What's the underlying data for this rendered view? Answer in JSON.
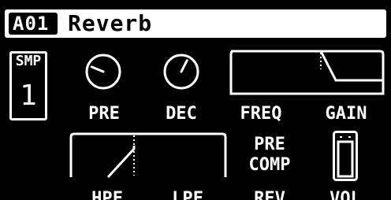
{
  "header": {
    "track_id": "A01",
    "preset_name": "Reverb"
  },
  "source": {
    "label": "SMP",
    "value": "1"
  },
  "params": {
    "pre": {
      "label": "PRE",
      "knob_level": 0.25
    },
    "dec": {
      "label": "DEC",
      "knob_level": 0.6
    },
    "freq": {
      "label": "FREQ"
    },
    "gain": {
      "label": "GAIN"
    },
    "hpf": {
      "label": "HPF"
    },
    "lpf": {
      "label": "LPF"
    },
    "rev": {
      "label": "REV",
      "stack_top": "PRE",
      "stack_bottom": "COMP"
    },
    "vol": {
      "label": "VOL"
    }
  }
}
